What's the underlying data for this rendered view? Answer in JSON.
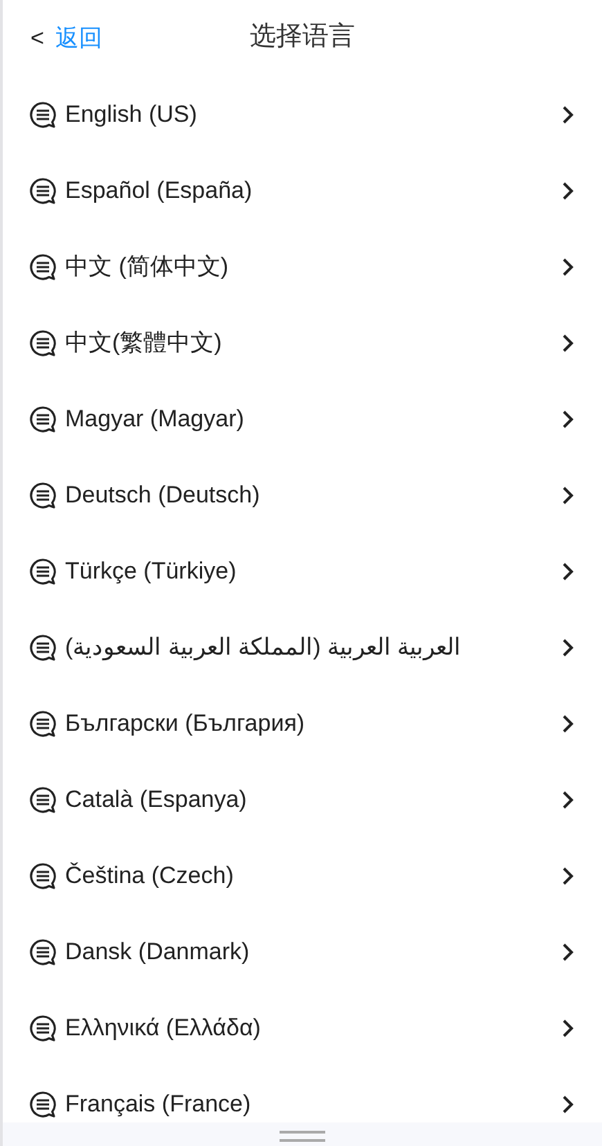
{
  "header": {
    "back_chevron": "<",
    "back_label": "返回",
    "title": "选择语言"
  },
  "languages": [
    {
      "label": "English (US)"
    },
    {
      "label": "Español (España)"
    },
    {
      "label": "中文 (简体中文)"
    },
    {
      "label": "中文(繁體中文)"
    },
    {
      "label": "Magyar (Magyar)"
    },
    {
      "label": "Deutsch (Deutsch)"
    },
    {
      "label": "Türkçe (Türkiye)"
    },
    {
      "label": "العربية العربية (المملكة العربية السعودية)"
    },
    {
      "label": "Български (България)"
    },
    {
      "label": "Català (Espanya)"
    },
    {
      "label": "Čeština (Czech)"
    },
    {
      "label": "Dansk (Danmark)"
    },
    {
      "label": "Ελληνικά (Ελλάδα)"
    },
    {
      "label": "Français (France)"
    }
  ]
}
